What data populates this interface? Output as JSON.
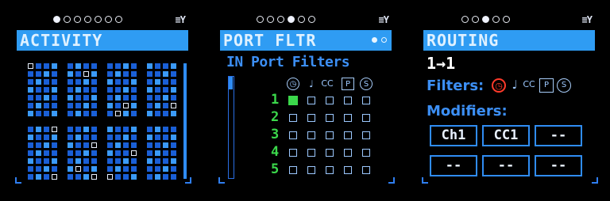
{
  "screens": {
    "activity": {
      "title": "ACTIVITY",
      "page_dots": 7,
      "active_dot": 0
    },
    "port_filter": {
      "title": "PORT FLTR",
      "page_dots": 6,
      "active_dot": 3,
      "subtitle": "IN Port Filters",
      "header_icons": [
        "clock-icon",
        "note-icon",
        "CC",
        "P",
        "S"
      ],
      "rows": [
        "1",
        "2",
        "3",
        "4",
        "5"
      ],
      "checked": [
        [
          true,
          false,
          false,
          false,
          false
        ],
        [
          false,
          false,
          false,
          false,
          false
        ],
        [
          false,
          false,
          false,
          false,
          false
        ],
        [
          false,
          false,
          false,
          false,
          false
        ],
        [
          false,
          false,
          false,
          false,
          false
        ]
      ]
    },
    "routing": {
      "title": "ROUTING",
      "page_dots": 5,
      "active_dot": 2,
      "route": "1→1",
      "filters_label": "Filters:",
      "filter_icons": [
        "clock-icon",
        "note-icon",
        "CC",
        "P",
        "S"
      ],
      "modifiers_label": "Modifiers:",
      "modifiers": [
        "Ch1",
        "CC1",
        "--",
        "--",
        "--",
        "--"
      ]
    }
  },
  "colors": {
    "accent": "#2f9cf3",
    "check_green": "#3bd84b",
    "alert_red": "#ff3a2a"
  }
}
